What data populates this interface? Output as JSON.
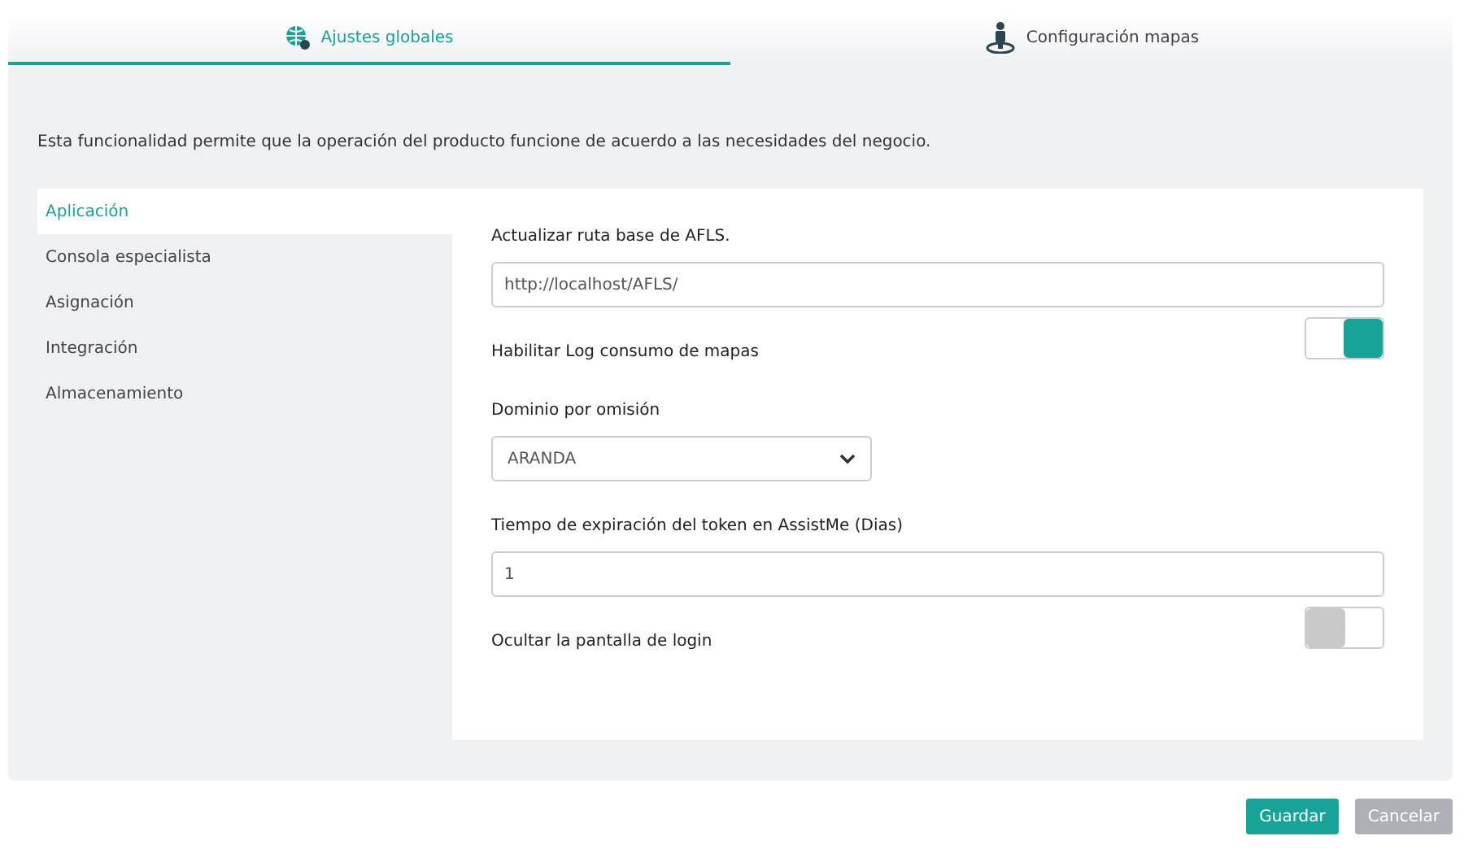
{
  "tabs": [
    {
      "label": "Ajustes globales",
      "selected": true
    },
    {
      "label": "Configuración mapas",
      "selected": false
    }
  ],
  "description": "Esta funcionalidad permite que la operación del producto funcione de acuerdo a las necesidades del negocio.",
  "sidebar": {
    "items": [
      {
        "label": "Aplicación",
        "selected": true
      },
      {
        "label": "Consola especialista",
        "selected": false
      },
      {
        "label": "Asignación",
        "selected": false
      },
      {
        "label": "Integración",
        "selected": false
      },
      {
        "label": "Almacenamiento",
        "selected": false
      }
    ]
  },
  "settings": [
    {
      "kind": "text",
      "label": "Actualizar ruta base de AFLS.",
      "value": "http://localhost/AFLS/"
    },
    {
      "kind": "toggle",
      "label": "Habilitar Log consumo de mapas",
      "on": true
    },
    {
      "kind": "select",
      "label": "Dominio por omisión",
      "value": "ARANDA"
    },
    {
      "kind": "text",
      "label": "Tiempo de expiración del token en AssistMe (Dias)",
      "value": "1"
    },
    {
      "kind": "toggle",
      "label": "Ocultar la pantalla de login",
      "on": false
    }
  ],
  "buttons": [
    {
      "label": "Guardar",
      "disabled": false
    },
    {
      "label": "Cancelar",
      "disabled": true
    }
  ]
}
